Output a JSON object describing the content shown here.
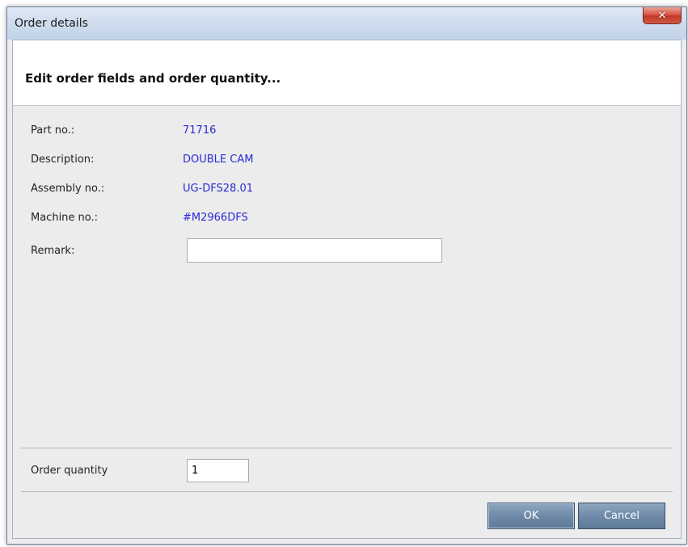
{
  "window": {
    "title": "Order details",
    "close_symbol": "✕"
  },
  "header": {
    "text": "Edit order fields and order quantity..."
  },
  "fields": [
    {
      "label": "Part no.:",
      "value": "71716"
    },
    {
      "label": "Description:",
      "value": "DOUBLE CAM"
    },
    {
      "label": "Assembly no.:",
      "value": "UG-DFS28.01"
    },
    {
      "label": "Machine no.:",
      "value": "#M2966DFS"
    }
  ],
  "remark": {
    "label": "Remark:",
    "value": ""
  },
  "order_quantity": {
    "label": "Order quantity",
    "value": "1"
  },
  "buttons": {
    "ok": "OK",
    "cancel": "Cancel"
  },
  "colors": {
    "value_text": "#2b2bd6",
    "button": "#6f8aa8"
  }
}
